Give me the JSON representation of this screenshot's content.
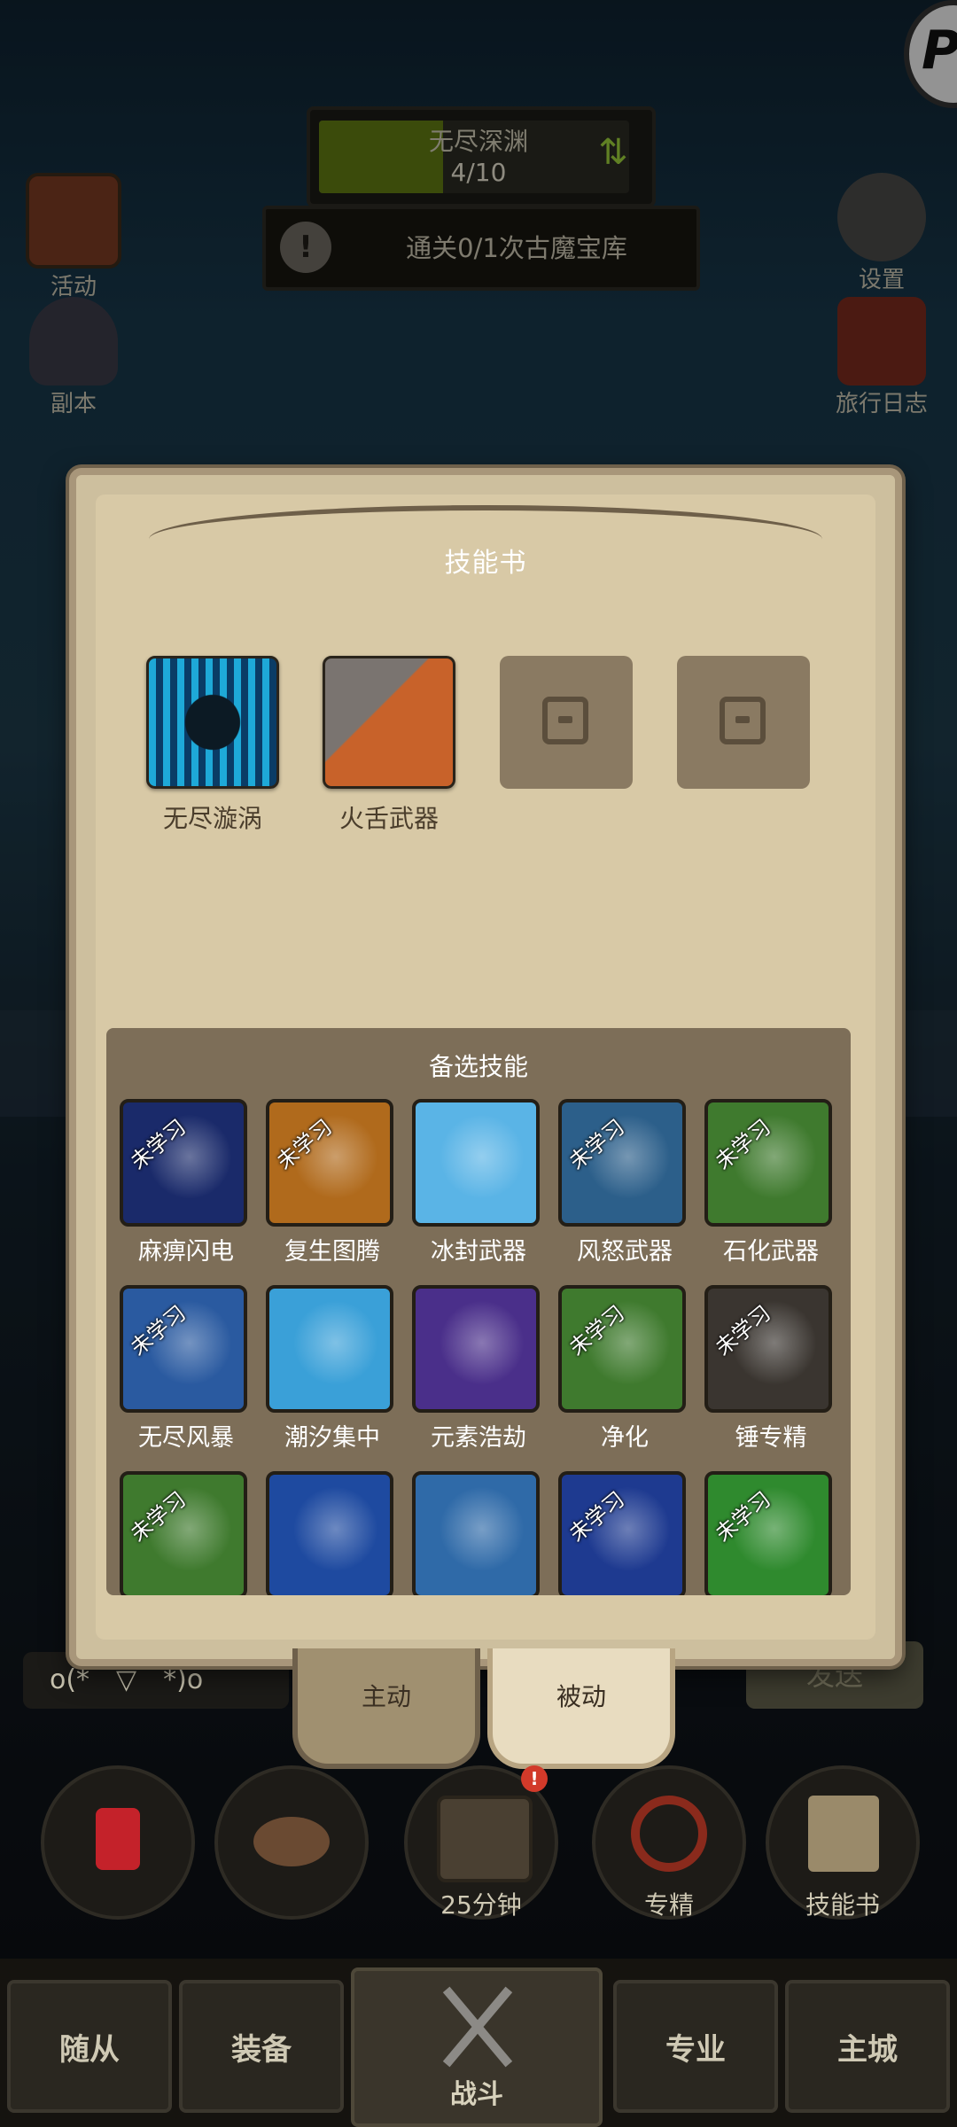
{
  "top": {
    "abyss": {
      "name": "无尽深渊",
      "progress_text": "4/10",
      "progress": 0.4
    },
    "quest": {
      "text": "通关0/1次古魔宝库"
    },
    "left_buttons": [
      {
        "label": "活动"
      },
      {
        "label": "副本"
      }
    ],
    "right_buttons": [
      {
        "label": "设置"
      },
      {
        "label": "旅行日志"
      }
    ]
  },
  "skillbook": {
    "title": "技能书",
    "equipped": [
      {
        "label": "无尽漩涡",
        "icon": "vortex-icon",
        "color": "#1ea9d8"
      },
      {
        "label": "火舌武器",
        "icon": "flametongue-hammer-icon",
        "color": "#c8622a"
      }
    ],
    "alt_title": "备选技能",
    "unlearned_text": "未学习",
    "alt_skills": [
      {
        "label": "麻痹闪电",
        "color": "#1a2a6a",
        "unlearned": true
      },
      {
        "label": "复生图腾",
        "color": "#b06a1c",
        "unlearned": true
      },
      {
        "label": "冰封武器",
        "color": "#5ab4e6",
        "unlearned": false
      },
      {
        "label": "风怒武器",
        "color": "#2c5f8a",
        "unlearned": true
      },
      {
        "label": "石化武器",
        "color": "#3f7a2e",
        "unlearned": true
      },
      {
        "label": "无尽风暴",
        "color": "#2a5aa0",
        "unlearned": true
      },
      {
        "label": "潮汐集中",
        "color": "#3aa0d8",
        "unlearned": false
      },
      {
        "label": "元素浩劫",
        "color": "#4a2f8a",
        "unlearned": false
      },
      {
        "label": "净化",
        "color": "#3f7a2e",
        "unlearned": true
      },
      {
        "label": "锤专精",
        "color": "#3a3530",
        "unlearned": true
      },
      {
        "label": "",
        "color": "#3f7a2e",
        "unlearned": true
      },
      {
        "label": "",
        "color": "#1e4aa0",
        "unlearned": false
      },
      {
        "label": "",
        "color": "#2f6aa8",
        "unlearned": false
      },
      {
        "label": "",
        "color": "#1e3a90",
        "unlearned": true
      },
      {
        "label": "",
        "color": "#2f8a2e",
        "unlearned": true
      }
    ],
    "tabs": [
      {
        "label": "主动"
      },
      {
        "label": "被动"
      }
    ]
  },
  "chat": {
    "input_value": "o(*￣▽￣*)o",
    "send_label": "发送"
  },
  "actions": [
    {
      "label": "",
      "icon": "potion-icon"
    },
    {
      "label": "",
      "icon": "bread-icon"
    },
    {
      "label": "25分钟",
      "icon": "chest-icon"
    },
    {
      "label": "专精",
      "icon": "specialization-icon"
    },
    {
      "label": "技能书",
      "icon": "skillbook-icon"
    }
  ],
  "badge": "!",
  "nav": [
    {
      "label": "随从"
    },
    {
      "label": "装备"
    },
    {
      "label": "战斗"
    },
    {
      "label": "专业"
    },
    {
      "label": "主城"
    }
  ]
}
